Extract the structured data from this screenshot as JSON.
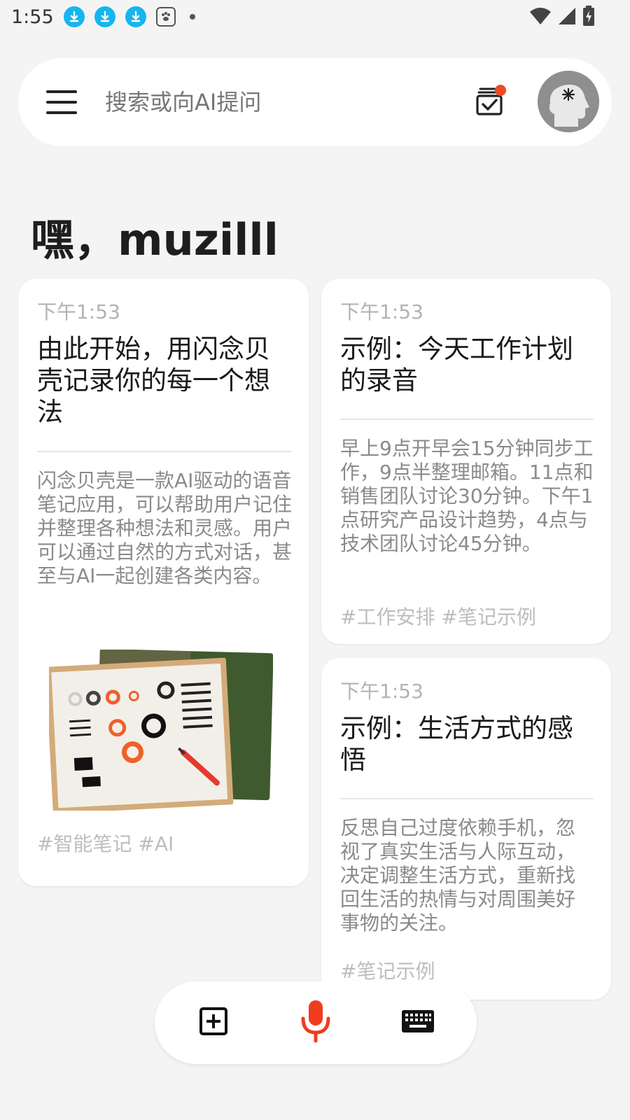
{
  "status_bar": {
    "time": "1:55",
    "icons": [
      "download-icon",
      "download-icon",
      "download-icon",
      "baidu-app-icon",
      "dot-icon",
      "wifi-icon",
      "signal-icon",
      "battery-charging-icon"
    ]
  },
  "search": {
    "placeholder": "搜索或向AI提问",
    "icons": [
      "menu-icon",
      "task-check-icon",
      "avatar"
    ],
    "badge_color": "#f04a23"
  },
  "greeting": "嘿，muzilll",
  "cards": [
    {
      "time": "下午1:53",
      "title": "由此开始，用闪念贝壳记录你的每一个想法",
      "body": "闪念贝壳是一款AI驱动的语音笔记应用，可以帮助用户记住并整理各种想法和灵感。用户可以通过自然的方式对话，甚至与AI一起创建各类内容。",
      "tags": "#智能笔记 #AI",
      "has_image": true
    },
    {
      "time": "下午1:53",
      "title": "示例：今天工作计划的录音",
      "body": "早上9点开早会15分钟同步工作，9点半整理邮箱。11点和销售团队讨论30分钟。下午1点研究产品设计趋势，4点与技术团队讨论45分钟。",
      "tags": "#工作安排 #笔记示例"
    },
    {
      "time": "下午1:53",
      "title": "示例：生活方式的感悟",
      "body": "反思自己过度依赖手机，忽视了真实生活与人际互动，决定调整生活方式，重新找回生活的热情与对周围美好事物的关注。",
      "tags": "#笔记示例"
    }
  ],
  "bottom_bar": {
    "buttons": [
      "add-note-icon",
      "mic-icon",
      "keyboard-icon"
    ],
    "mic_color": "#f03c1e"
  },
  "colors": {
    "background": "#f4f4f4",
    "accent": "#f04a23",
    "download_icon": "#16b5f0"
  }
}
